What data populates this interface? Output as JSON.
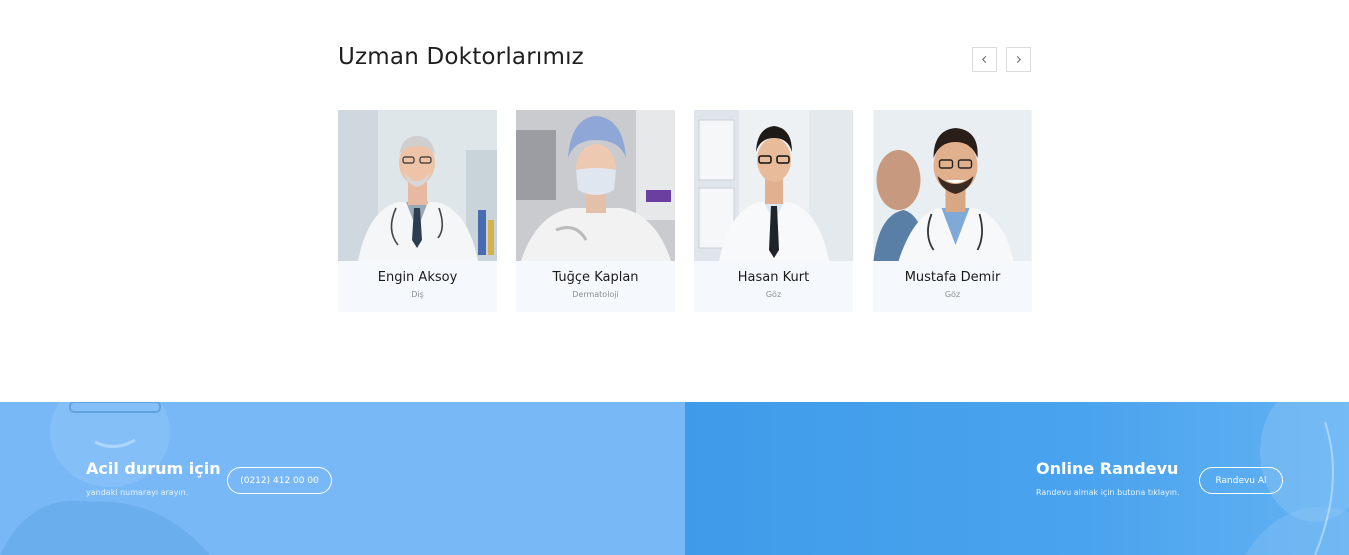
{
  "section": {
    "title": "Uzman Doktorlarımız",
    "prev_icon": "chevron-left-icon",
    "next_icon": "chevron-right-icon"
  },
  "doctors": [
    {
      "name": "Engin Aksoy",
      "specialty": "Diş"
    },
    {
      "name": "Tuğçe Kaplan",
      "specialty": "Dermatoloji"
    },
    {
      "name": "Hasan Kurt",
      "specialty": "Göz"
    },
    {
      "name": "Mustafa Demir",
      "specialty": "Göz"
    }
  ],
  "emergency": {
    "title": "Acil durum için",
    "subtitle": "yandaki numarayı arayın.",
    "phone_button": "(0212) 412 00 00"
  },
  "appointment": {
    "title": "Online Randevu",
    "subtitle": "Randevu almak için butona tıklayın.",
    "button": "Randevu Al"
  },
  "colors": {
    "card_bg": "#f5f9fd",
    "band_left": "#79b8f6",
    "band_right": "#3f9be9"
  }
}
